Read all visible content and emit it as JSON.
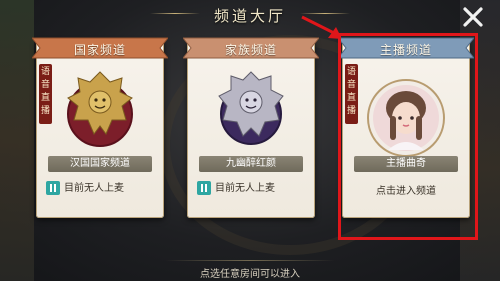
{
  "title": "频道大厅",
  "close_icon": "close-icon",
  "colors": {
    "highlight": "#e0161a",
    "nation_header": "#c8764a",
    "clan_header": "#c99070",
    "anchor_header": "#7f9bb8",
    "status_icon": "#2ea6a2"
  },
  "cards": [
    {
      "header": "国家频道",
      "voice_tag": [
        "语",
        "音",
        "直",
        "播"
      ],
      "emblem": "lion-crest-emblem",
      "name": "汉国国家频道",
      "status": "目前无人上麦"
    },
    {
      "header": "家族频道",
      "voice_tag": [],
      "emblem": "demon-crest-emblem",
      "name": "九幽醉红颜",
      "status": "目前无人上麦"
    },
    {
      "header": "主播频道",
      "voice_tag": [
        "语",
        "音",
        "直",
        "播"
      ],
      "emblem": "anchor-avatar",
      "name": "主播曲奇",
      "status": "点击进入频道"
    }
  ],
  "bottom_hint": "点选任意房间可以进入"
}
